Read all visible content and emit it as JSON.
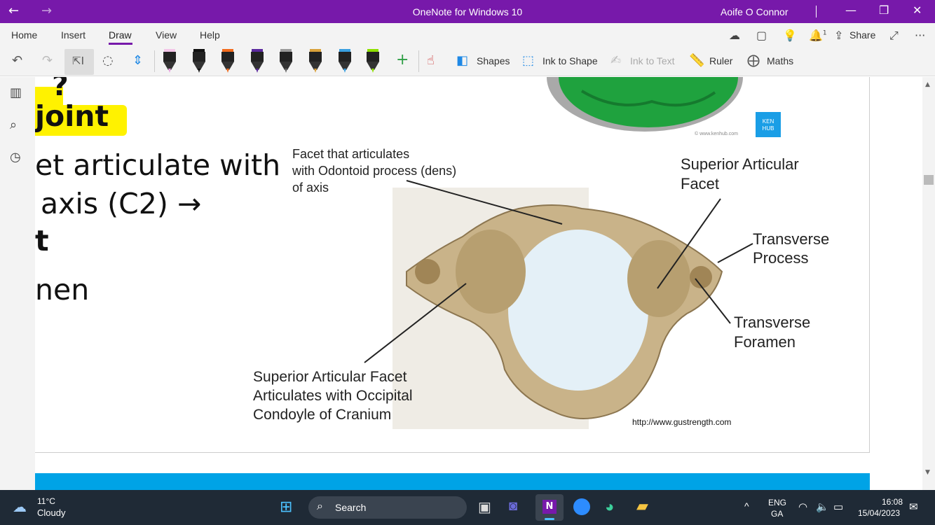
{
  "window": {
    "title": "OneNote for Windows 10",
    "user": "Aoife O Connor",
    "back": "←",
    "forward": "→",
    "minimize": "—",
    "restore": "❐",
    "close": "✕"
  },
  "menu": {
    "tabs": [
      "Home",
      "Insert",
      "Draw",
      "View",
      "Help"
    ],
    "active": "Draw",
    "share": "Share",
    "bell_count": "1",
    "more": "···"
  },
  "toolbar": {
    "shapes": "Shapes",
    "ink_to_shape": "Ink to Shape",
    "ink_to_text": "Ink to Text",
    "ruler": "Ruler",
    "maths": "Maths",
    "add": "+"
  },
  "pens": [
    {
      "color": "#f3c6e8",
      "tip": "#e8a0e0"
    },
    {
      "color": "#111111",
      "tip": "#111111"
    },
    {
      "color": "#f26b1d",
      "tip": "#f26b1d"
    },
    {
      "color": "#5b2a9e",
      "tip": "#5b2a9e"
    },
    {
      "color": "#9a9a9a",
      "tip": "#666666"
    },
    {
      "color": "#d9a23b",
      "tip": "#d9a23b"
    },
    {
      "color": "#3aa0e0",
      "tip": "#3aa0e0"
    },
    {
      "color": "#8ee000",
      "tip": "#8ee000"
    }
  ],
  "note": {
    "line1": "?",
    "line2": "joint",
    "line3": "et articulate with",
    "line4": "axis (C2) →",
    "line5": "t",
    "line6": "nen"
  },
  "figure": {
    "facet_label": [
      "Facet that articulates",
      "with Odontoid process (dens)",
      "of axis"
    ],
    "superior_facet": [
      "Superior Articular",
      "Facet"
    ],
    "transverse_process": [
      "Transverse",
      "Process"
    ],
    "transverse_foramen": [
      "Transverse",
      "Foramen"
    ],
    "bottom_label": [
      "Superior Articular Facet",
      "Articulates with Occipital",
      "Condoyle of Cranium"
    ],
    "url": "http://www.gustrength.com",
    "kenhub": [
      "KEN",
      "HUB"
    ],
    "kenhub_url": "© www.kenhub.com"
  },
  "taskbar": {
    "temp": "11°C",
    "weather": "Cloudy",
    "search": "Search",
    "lang1": "ENG",
    "lang2": "GA",
    "time": "16:08",
    "date": "15/04/2023",
    "chevron": "^"
  },
  "colors": {
    "accent": "#7719aa",
    "highlight": "#fff200",
    "taskbar": "#1f2a36"
  }
}
